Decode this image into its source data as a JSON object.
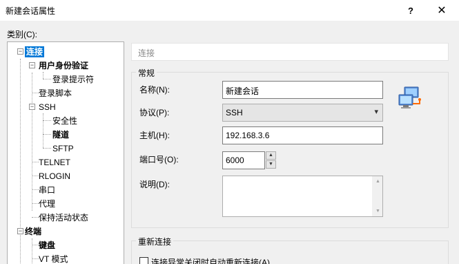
{
  "window": {
    "title": "新建会话属性",
    "help_label": "?",
    "close_label": "✕"
  },
  "category_label": "类别(C):",
  "tree": {
    "items": [
      {
        "label": "连接"
      },
      {
        "label": "用户身份验证"
      },
      {
        "label": "登录提示符"
      },
      {
        "label": "登录脚本"
      },
      {
        "label": "SSH"
      },
      {
        "label": "安全性"
      },
      {
        "label": "隧道"
      },
      {
        "label": "SFTP"
      },
      {
        "label": "TELNET"
      },
      {
        "label": "RLOGIN"
      },
      {
        "label": "串口"
      },
      {
        "label": "代理"
      },
      {
        "label": "保持活动状态"
      },
      {
        "label": "终端"
      },
      {
        "label": "键盘"
      },
      {
        "label": "VT 模式"
      }
    ],
    "toggle_minus": "−"
  },
  "section_header": "连接",
  "general": {
    "title": "常规",
    "name_label": "名称(N):",
    "name_value": "新建会话",
    "protocol_label": "协议(P):",
    "protocol_value": "SSH",
    "host_label": "主机(H):",
    "host_value": "192.168.3.6",
    "port_label": "端口号(O):",
    "port_value": "6000",
    "desc_label": "说明(D):",
    "desc_value": ""
  },
  "reconnect": {
    "title": "重新连接",
    "checkbox_label": "连接异常关闭时自动重新连接(A)"
  },
  "icons": {
    "network": "network-computers-icon",
    "chevron": "▾",
    "spin_up": "▲",
    "spin_down": "▼"
  }
}
